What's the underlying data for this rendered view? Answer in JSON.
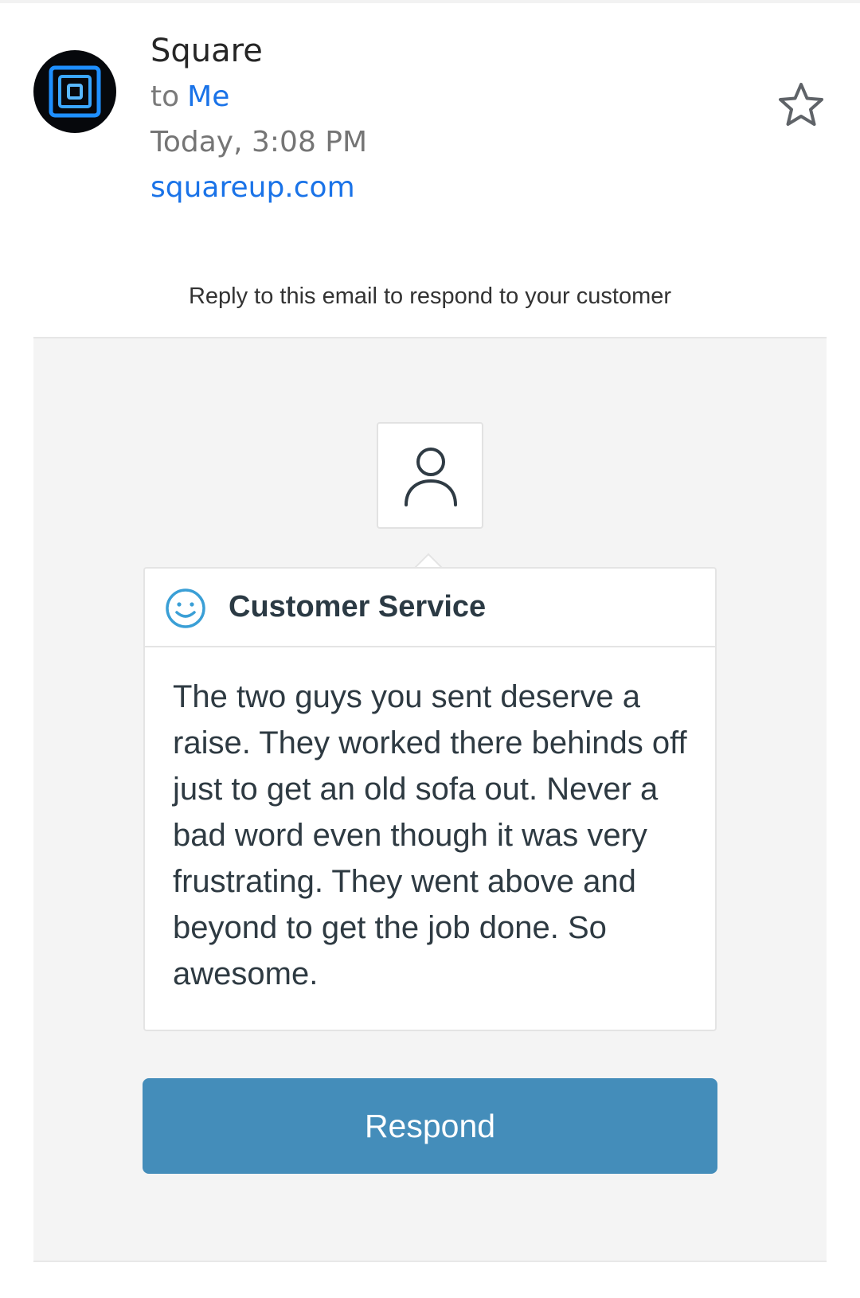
{
  "email": {
    "sender": "Square",
    "to_label": "to",
    "recipient": "Me",
    "date": "Today, 3:08 PM",
    "sender_domain": "squareup.com",
    "star_icon": "star-outline-icon",
    "avatar_icon": "square-logo"
  },
  "content": {
    "notice": "Reply to this email to respond to your customer",
    "customer_icon": "person-icon",
    "card": {
      "icon": "smile-icon",
      "title": "Customer Service",
      "message": "The two guys you sent deserve a raise. They worked there behinds off just to get an old sofa out. Never a bad word even though it was very frustrating. They went above and beyond to get the job done. So awesome."
    },
    "respond_label": "Respond"
  },
  "colors": {
    "link": "#1a73e8",
    "button": "#448dba",
    "panel": "#f4f4f4",
    "smile": "#3a9fd6",
    "logo_glow": "#1e8fff"
  }
}
